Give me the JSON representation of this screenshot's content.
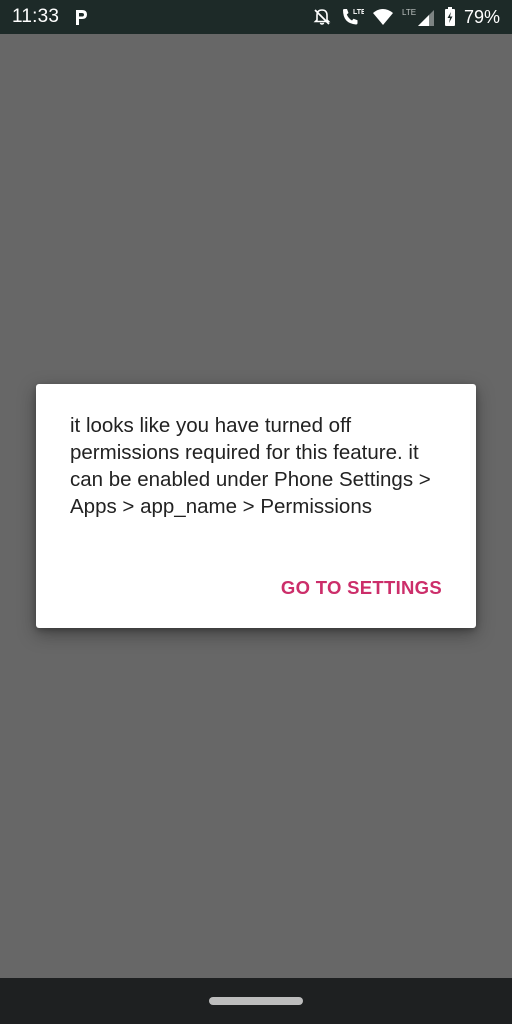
{
  "status_bar": {
    "time": "11:33",
    "app_icon": "parking-p-icon",
    "battery_percent": "79%",
    "icons": [
      "notifications-off-icon",
      "lte-call-icon",
      "wifi-icon",
      "lte-signal-icon",
      "battery-icon"
    ],
    "lte_label": "LTE"
  },
  "dialog": {
    "message": "it looks like you have turned off permissions required for this feature. it can be enabled under Phone Settings > Apps > app_name > Permissions",
    "action_label": "GO TO SETTINGS",
    "accent_color": "#cc2e6a"
  },
  "colors": {
    "scrim": "#676767",
    "status_bar": "#1d2a28",
    "nav_bar": "#1e2021"
  }
}
